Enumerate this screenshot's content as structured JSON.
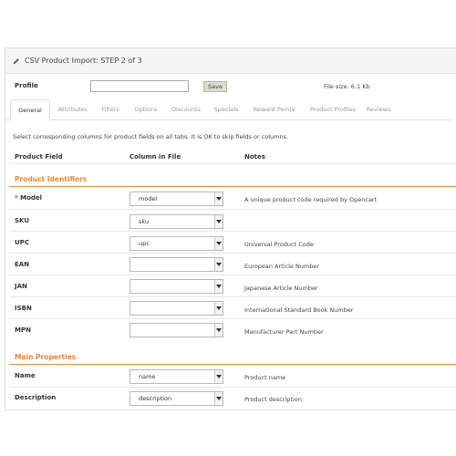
{
  "panel": {
    "title": "CSV Product Import: STEP 2 of 3"
  },
  "profile": {
    "label": "Profile",
    "input_value": "",
    "save_label": "Save",
    "file_size": "File size: 6.1 Kb"
  },
  "tabs": [
    {
      "label": "General",
      "active": true
    },
    {
      "label": "Attributes",
      "active": false
    },
    {
      "label": "Filters",
      "active": false
    },
    {
      "label": "Options",
      "active": false
    },
    {
      "label": "Discounts",
      "active": false
    },
    {
      "label": "Specials",
      "active": false
    },
    {
      "label": "Reward Points",
      "active": false
    },
    {
      "label": "Product Profiles",
      "active": false
    },
    {
      "label": "Reviews",
      "active": false
    }
  ],
  "instructions": "Select corresponding columns for product fields on all tabs. It is OK to skip fields or columns.",
  "columns": {
    "field": "Product Field",
    "column": "Column in File",
    "notes": "Notes"
  },
  "sections": {
    "identifiers": {
      "title": "Product Identifiers",
      "rows": [
        {
          "required_mark": "*",
          "name": "Model",
          "value": "model",
          "note": "A unique product code required by Opencart"
        },
        {
          "required_mark": "",
          "name": "SKU",
          "value": "sku",
          "note": ""
        },
        {
          "required_mark": "",
          "name": "UPC",
          "value": "upc",
          "note": "Universal Product Code"
        },
        {
          "required_mark": "",
          "name": "EAN",
          "value": "",
          "note": "European Article Number"
        },
        {
          "required_mark": "",
          "name": "JAN",
          "value": "",
          "note": "Japanese Article Number"
        },
        {
          "required_mark": "",
          "name": "ISBN",
          "value": "",
          "note": "International Standard Book Number"
        },
        {
          "required_mark": "",
          "name": "MPN",
          "value": "",
          "note": "Manufacturer Part Number"
        }
      ]
    },
    "main": {
      "title": "Main Properties",
      "rows": [
        {
          "required_mark": "",
          "name": "Name",
          "value": "name",
          "note": "Product name"
        },
        {
          "required_mark": "",
          "name": "Description",
          "value": "description",
          "note": "Product description"
        }
      ]
    }
  },
  "icons": {
    "title_icon": "pencil-icon",
    "select_arrow": "chevron-down-icon"
  },
  "colors": {
    "accent": "#e8883a",
    "required": "#e03030"
  }
}
